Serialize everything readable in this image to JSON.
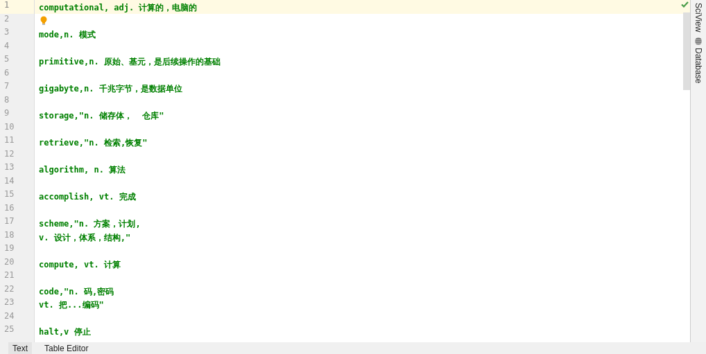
{
  "editor": {
    "inspection_ok": true,
    "lines": [
      {
        "number": "1",
        "kind": "text",
        "text": "computational, adj. 计算的，电脑的",
        "current": true
      },
      {
        "number": "2",
        "kind": "hint",
        "current": false
      },
      {
        "number": "3",
        "kind": "text",
        "text": "mode,n. 模式",
        "current": false
      },
      {
        "number": "4",
        "kind": "blank",
        "current": false
      },
      {
        "number": "5",
        "kind": "text",
        "text": "primitive,n. 原始、基元，是后续操作的基础",
        "current": false
      },
      {
        "number": "6",
        "kind": "blank",
        "current": false
      },
      {
        "number": "7",
        "kind": "text",
        "text": "gigabyte,n. 千兆字节，是数据单位",
        "current": false
      },
      {
        "number": "8",
        "kind": "blank",
        "current": false
      },
      {
        "number": "9",
        "kind": "text",
        "text": "storage,\"n. 储存体，  仓库\"",
        "current": false
      },
      {
        "number": "10",
        "kind": "blank",
        "current": false
      },
      {
        "number": "11",
        "kind": "text",
        "text": "retrieve,\"n. 检索,恢复\"",
        "current": false
      },
      {
        "number": "12",
        "kind": "blank",
        "current": false
      },
      {
        "number": "13",
        "kind": "text",
        "text": "algorithm, n. 算法",
        "current": false
      },
      {
        "number": "14",
        "kind": "blank",
        "current": false
      },
      {
        "number": "15",
        "kind": "text",
        "text": "accomplish, vt. 完成",
        "current": false
      },
      {
        "number": "16",
        "kind": "blank",
        "current": false
      },
      {
        "number": "17",
        "kind": "text",
        "text": "scheme,\"n. 方案，计划,",
        "current": false
      },
      {
        "number": "18",
        "kind": "text",
        "text": "v. 设计，体系，结构,\"",
        "current": false
      },
      {
        "number": "19",
        "kind": "blank",
        "current": false
      },
      {
        "number": "20",
        "kind": "text",
        "text": "compute, vt. 计算",
        "current": false
      },
      {
        "number": "21",
        "kind": "blank",
        "current": false
      },
      {
        "number": "22",
        "kind": "text",
        "text": "code,\"n. 码,密码",
        "current": false
      },
      {
        "number": "23",
        "kind": "text",
        "text": "vt. 把...编码\"",
        "current": false
      },
      {
        "number": "24",
        "kind": "blank",
        "current": false
      },
      {
        "number": "25",
        "kind": "text",
        "text": "halt,v 停止",
        "current": false
      }
    ]
  },
  "side_tools": [
    {
      "label": "SciView",
      "kind": "plain"
    },
    {
      "label": "Database",
      "kind": "database"
    }
  ],
  "bottom_tabs": [
    {
      "label": "Text",
      "selected": true
    },
    {
      "label": "Table Editor",
      "selected": false
    }
  ]
}
